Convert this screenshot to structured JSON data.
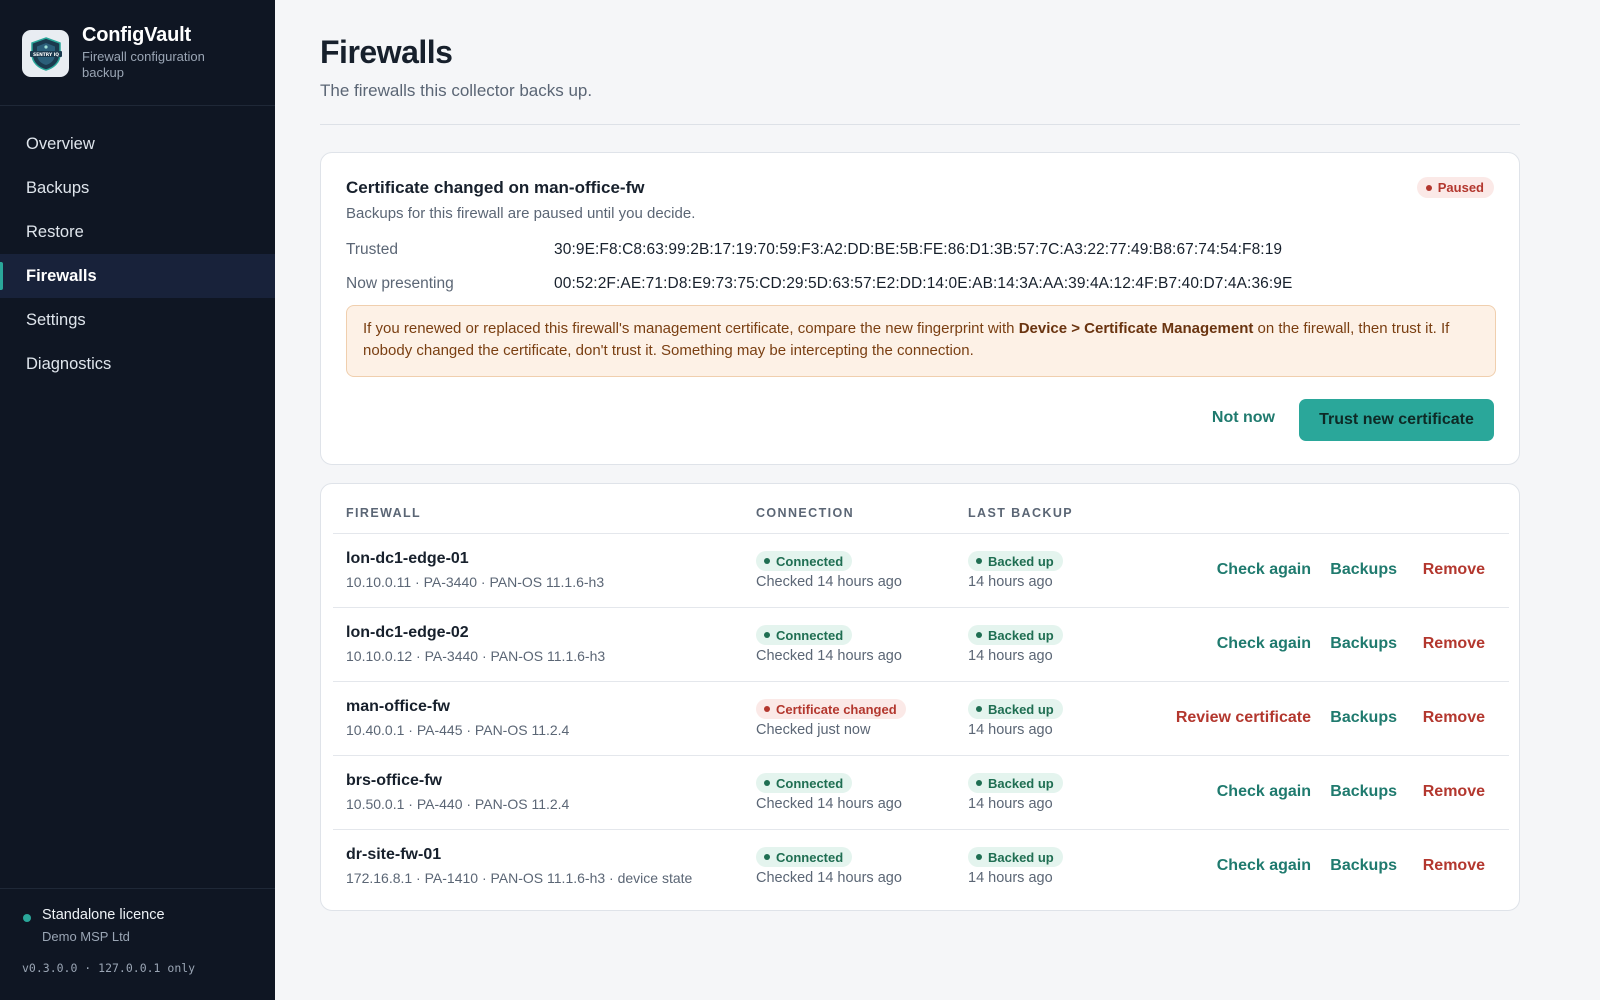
{
  "brand": {
    "title": "ConfigVault",
    "subtitle": "Firewall configuration backup",
    "logo_text": "SENTRY IQ"
  },
  "nav": [
    {
      "label": "Overview",
      "active": false
    },
    {
      "label": "Backups",
      "active": false
    },
    {
      "label": "Restore",
      "active": false
    },
    {
      "label": "Firewalls",
      "active": true
    },
    {
      "label": "Settings",
      "active": false
    },
    {
      "label": "Diagnostics",
      "active": false
    }
  ],
  "footer": {
    "licence": "Standalone licence",
    "org": "Demo MSP Ltd",
    "version": "v0.3.0.0 · 127.0.0.1 only"
  },
  "page": {
    "title": "Firewalls",
    "subtitle": "The firewalls this collector backs up."
  },
  "alert": {
    "title": "Certificate changed on man-office-fw",
    "subtitle": "Backups for this firewall are paused until you decide.",
    "status": "Paused",
    "trusted_label": "Trusted",
    "trusted_fp": "30:9E:F8:C8:63:99:2B:17:19:70:59:F3:A2:DD:BE:5B:FE:86:D1:3B:57:7C:A3:22:77:49:B8:67:74:54:F8:19",
    "presenting_label": "Now presenting",
    "presenting_fp": "00:52:2F:AE:71:D8:E9:73:75:CD:29:5D:63:57:E2:DD:14:0E:AB:14:3A:AA:39:4A:12:4F:B7:40:D7:4A:36:9E",
    "warning_pre": "If you renewed or replaced this firewall's management certificate, compare the new fingerprint with ",
    "warning_bold": "Device > Certificate Management",
    "warning_post": " on the firewall, then trust it. If nobody changed the certificate, don't trust it. Something may be intercepting the connection.",
    "not_now": "Not now",
    "trust": "Trust new certificate"
  },
  "table": {
    "headers": {
      "firewall": "FIREWALL",
      "connection": "CONNECTION",
      "last_backup": "LAST BACKUP"
    },
    "rows": [
      {
        "name": "lon-dc1-edge-01",
        "meta": "10.10.0.11 · PA-3440 · PAN-OS 11.1.6-h3",
        "conn": "Connected",
        "conn_state": "ok",
        "checked": "Checked 14 hours ago",
        "backup": "Backed up",
        "backup_age": "14 hours ago",
        "primary_action": "Check again",
        "backups": "Backups",
        "remove": "Remove"
      },
      {
        "name": "lon-dc1-edge-02",
        "meta": "10.10.0.12 · PA-3440 · PAN-OS 11.1.6-h3",
        "conn": "Connected",
        "conn_state": "ok",
        "checked": "Checked 14 hours ago",
        "backup": "Backed up",
        "backup_age": "14 hours ago",
        "primary_action": "Check again",
        "backups": "Backups",
        "remove": "Remove"
      },
      {
        "name": "man-office-fw",
        "meta": "10.40.0.1 · PA-445 · PAN-OS 11.2.4",
        "conn": "Certificate changed",
        "conn_state": "warn",
        "checked": "Checked just now",
        "backup": "Backed up",
        "backup_age": "14 hours ago",
        "primary_action": "Review certificate",
        "backups": "Backups",
        "remove": "Remove"
      },
      {
        "name": "brs-office-fw",
        "meta": "10.50.0.1 · PA-440 · PAN-OS 11.2.4",
        "conn": "Connected",
        "conn_state": "ok",
        "checked": "Checked 14 hours ago",
        "backup": "Backed up",
        "backup_age": "14 hours ago",
        "primary_action": "Check again",
        "backups": "Backups",
        "remove": "Remove"
      },
      {
        "name": "dr-site-fw-01",
        "meta": "172.16.8.1 · PA-1410 · PAN-OS 11.1.6-h3 · device state",
        "conn": "Connected",
        "conn_state": "ok",
        "checked": "Checked 14 hours ago",
        "backup": "Backed up",
        "backup_age": "14 hours ago",
        "primary_action": "Check again",
        "backups": "Backups",
        "remove": "Remove"
      }
    ]
  },
  "colors": {
    "sidebar_bg": "#0f1623",
    "accent": "#2aa79a",
    "danger": "#b3372e",
    "ok": "#1f6e52",
    "warning_bg": "#fdf1e6"
  }
}
